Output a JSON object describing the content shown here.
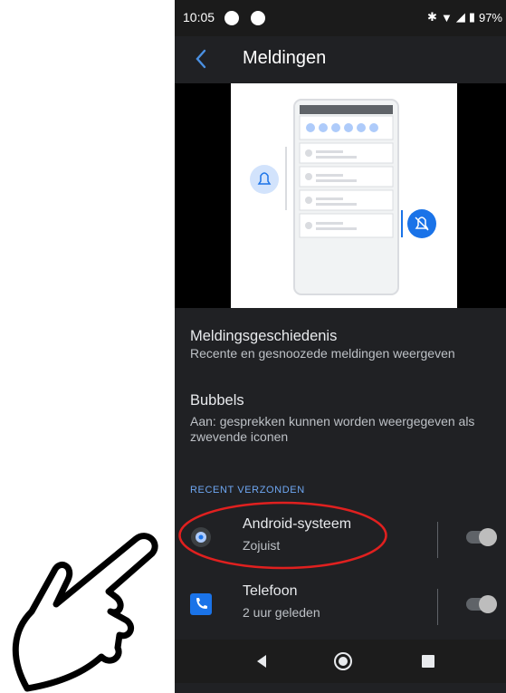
{
  "status_bar": {
    "time": "10:05",
    "battery": "97%"
  },
  "app_bar": {
    "title": "Meldingen"
  },
  "settings": [
    {
      "title": "Meldingsgeschiedenis",
      "subtitle": "Recente en gesnoozede meldingen weergeven"
    },
    {
      "title": "Bubbels",
      "subtitle": "Aan: gesprekken kunnen worden weergegeven als zwevende iconen"
    }
  ],
  "section_header": "RECENT VERZONDEN",
  "recent_apps": [
    {
      "name": "Android-systeem",
      "time": "Zojuist",
      "icon": "android-system-icon",
      "enabled": true
    },
    {
      "name": "Telefoon",
      "time": "2 uur geleden",
      "icon": "phone-icon",
      "enabled": true
    }
  ],
  "colors": {
    "background": "#202124",
    "accent": "#6ea7f2",
    "highlight": "#e0201f",
    "phone_icon_bg": "#1a73e8"
  }
}
